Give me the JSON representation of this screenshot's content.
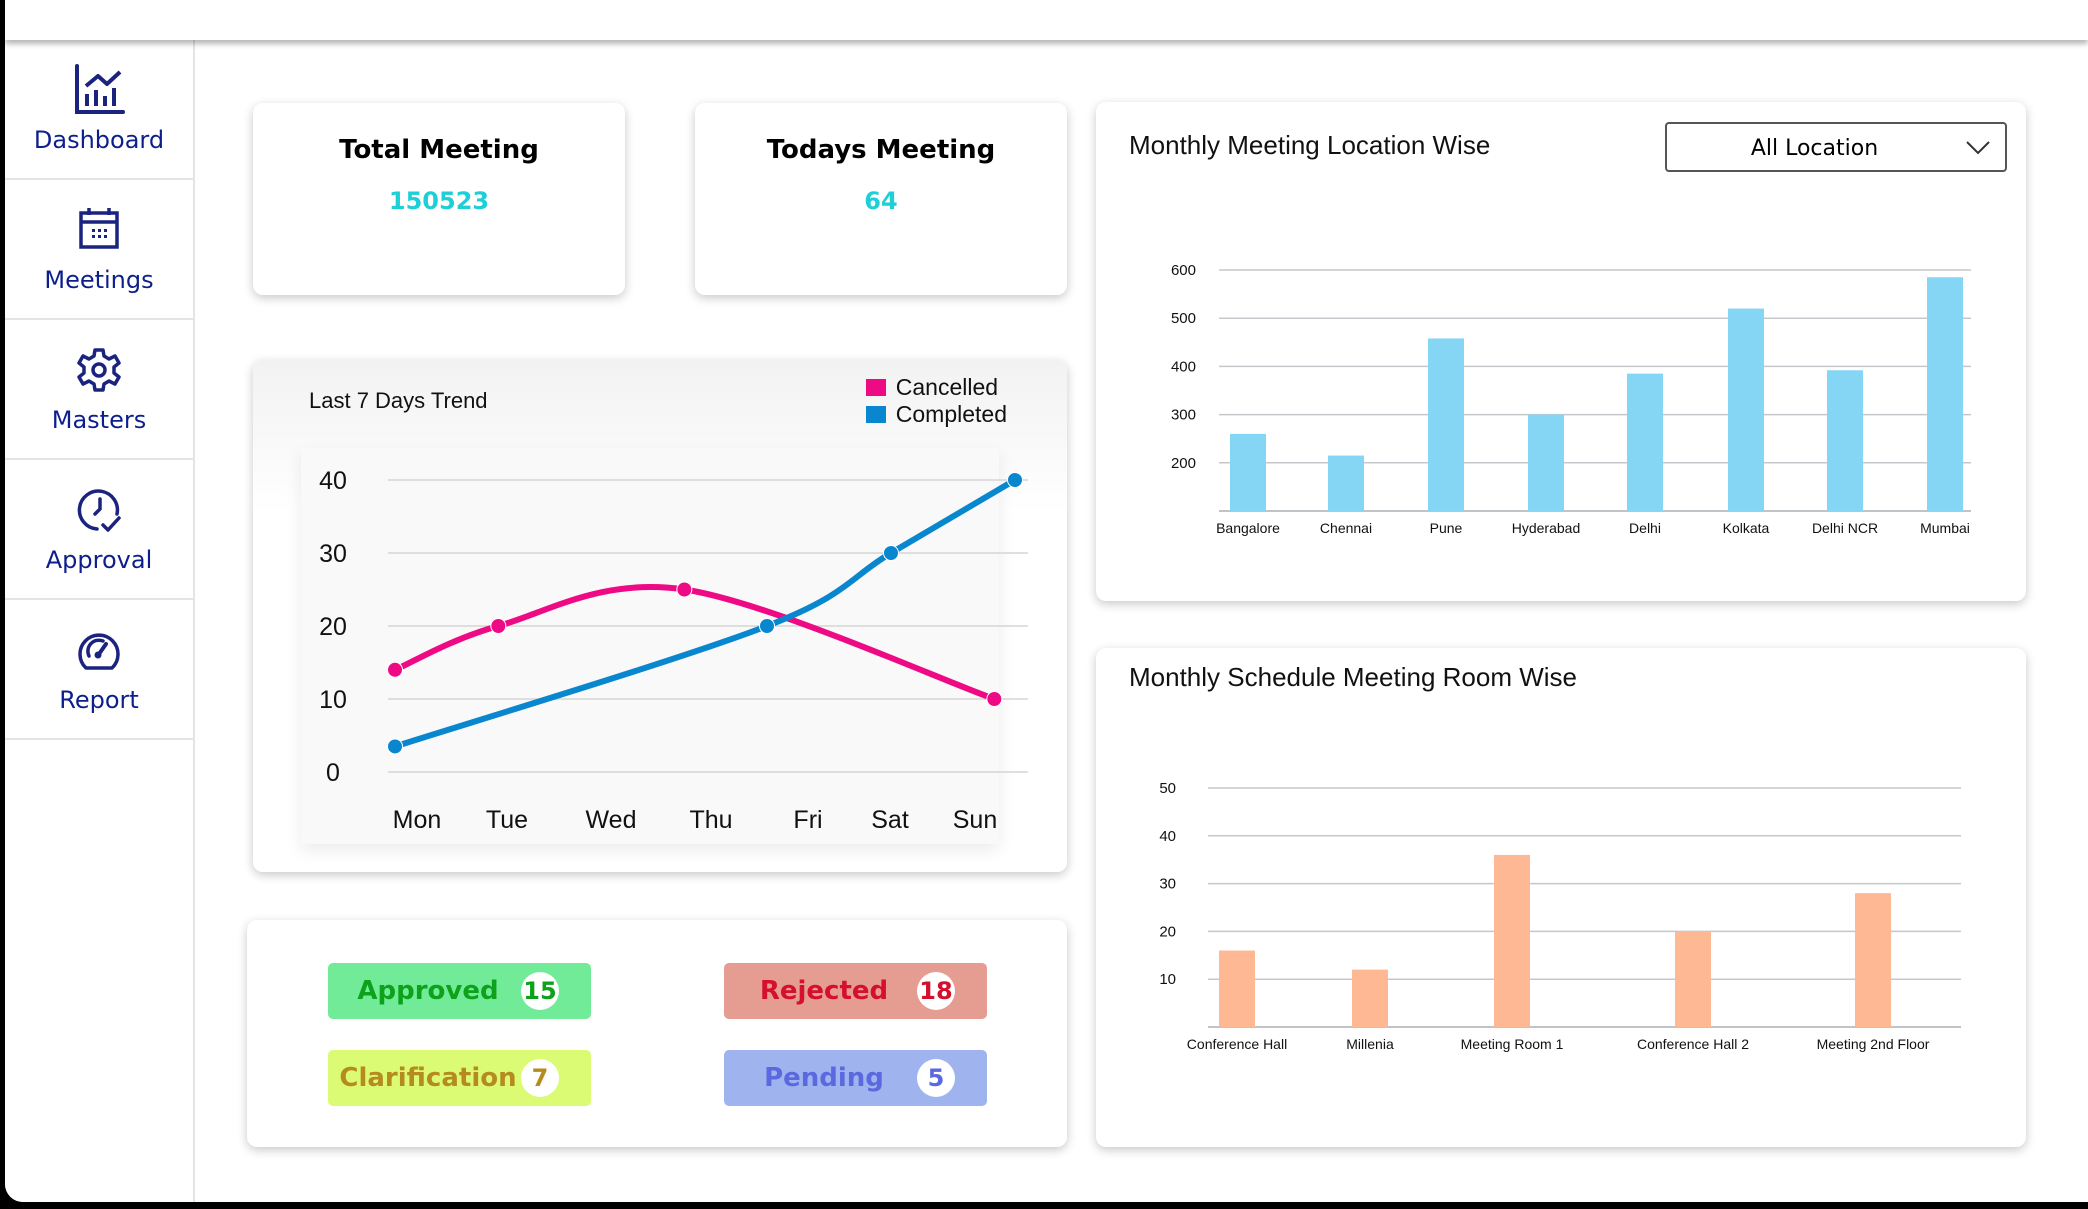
{
  "sidebar": {
    "items": [
      {
        "label": "Dashboard",
        "icon": "chart-icon"
      },
      {
        "label": "Meetings",
        "icon": "calendar-icon"
      },
      {
        "label": "Masters",
        "icon": "gear-icon"
      },
      {
        "label": "Approval",
        "icon": "clock-check-icon"
      },
      {
        "label": "Report",
        "icon": "speedometer-icon"
      }
    ],
    "active": "Dashboard"
  },
  "stats": {
    "total": {
      "title": "Total Meeting",
      "value": "150523"
    },
    "today": {
      "title": "Todays Meeting",
      "value": "64"
    }
  },
  "status": {
    "approved": {
      "label": "Approved",
      "count": "15",
      "bg": "#72eb98",
      "fg": "#0ea21c"
    },
    "rejected": {
      "label": "Rejected",
      "count": "18",
      "bg": "#e49d90",
      "fg": "#d4102c"
    },
    "clarification": {
      "label": "Clarification",
      "count": "7",
      "bg": "#dcfb74",
      "fg": "#b58a1e"
    },
    "pending": {
      "label": "Pending",
      "count": "5",
      "bg": "#9fb4ee",
      "fg": "#5b68df"
    }
  },
  "location_filter": {
    "selected": "All Location"
  },
  "chart_data": [
    {
      "type": "line",
      "title": "Last 7 Days Trend",
      "categories": [
        "Mon",
        "Tue",
        "Wed",
        "Thu",
        "Fri",
        "Sat",
        "Sun"
      ],
      "yticks": [
        "0",
        "10",
        "20",
        "30",
        "40"
      ],
      "ylim": [
        0,
        40
      ],
      "legend_position": "top-right",
      "smooth": true,
      "grid": true,
      "series": [
        {
          "name": "Cancelled",
          "color": "#ee0a84",
          "points": [
            [
              0,
              14
            ],
            [
              1,
              20
            ],
            [
              2.8,
              25
            ],
            [
              5.8,
              10
            ]
          ]
        },
        {
          "name": "Completed",
          "color": "#0887cf",
          "points": [
            [
              0,
              3.5
            ],
            [
              3.6,
              20
            ],
            [
              4.8,
              30
            ],
            [
              6,
              40
            ]
          ]
        }
      ]
    },
    {
      "type": "bar",
      "title": "Monthly Meeting Location Wise",
      "categories": [
        "Bangalore",
        "Chennai",
        "Pune",
        "Hyderabad",
        "Delhi",
        "Kolkata",
        "Delhi NCR",
        "Mumbai"
      ],
      "values": [
        260,
        215,
        458,
        300,
        385,
        520,
        392,
        585
      ],
      "yticks": [
        "200",
        "300",
        "400",
        "500",
        "600"
      ],
      "ylim": [
        100,
        600
      ],
      "color": "#85d6f5",
      "grid": true,
      "xlabel": "",
      "ylabel": ""
    },
    {
      "type": "bar",
      "title": "Monthly Schedule Meeting Room Wise",
      "categories": [
        "Conference Hall",
        "Millenia",
        "Meeting Room 1",
        "Conference Hall 2",
        "Meeting 2nd Floor"
      ],
      "values": [
        16,
        12,
        36,
        20,
        28
      ],
      "yticks": [
        "10",
        "20",
        "30",
        "40",
        "50"
      ],
      "ylim": [
        0,
        50
      ],
      "color": "#ffb894",
      "grid": true,
      "xlabel": "",
      "ylabel": ""
    }
  ]
}
